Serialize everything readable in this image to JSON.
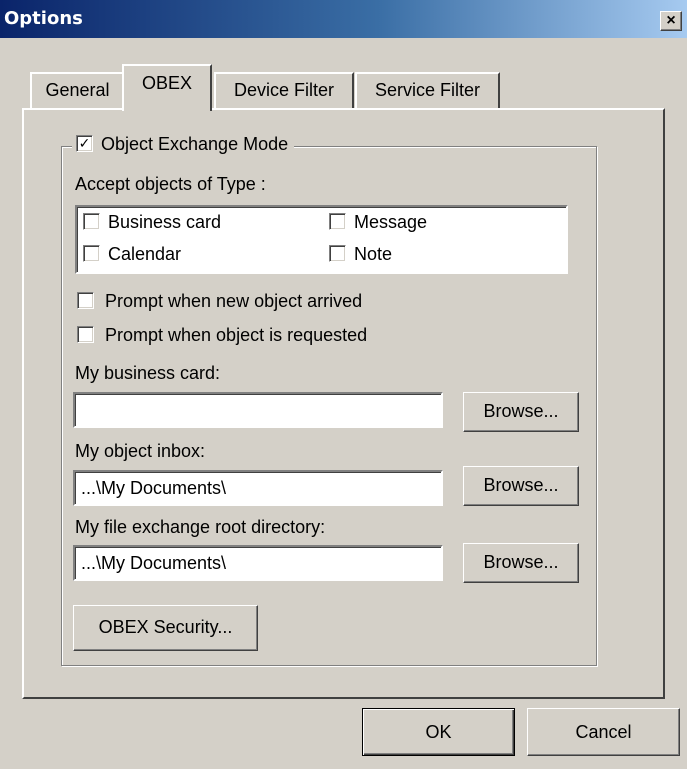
{
  "window": {
    "title": "Options",
    "close_glyph": "×"
  },
  "tabs": [
    {
      "label": "General",
      "selected": false
    },
    {
      "label": "OBEX",
      "selected": true
    },
    {
      "label": "Device Filter",
      "selected": false
    },
    {
      "label": "Service Filter",
      "selected": false
    }
  ],
  "obex": {
    "mode_label": "Object Exchange Mode",
    "mode_checked": true,
    "accept_label": "Accept objects of Type :",
    "types": [
      {
        "label": "Business card",
        "checked": false
      },
      {
        "label": "Message",
        "checked": false
      },
      {
        "label": "Calendar",
        "checked": false
      },
      {
        "label": "Note",
        "checked": false
      }
    ],
    "prompt_arrived": {
      "label": "Prompt when new object arrived",
      "checked": false
    },
    "prompt_requested": {
      "label": "Prompt when object is requested",
      "checked": false
    },
    "business_card": {
      "label": "My business card:",
      "value": "",
      "browse": "Browse..."
    },
    "inbox": {
      "label": "My object inbox:",
      "value": "...\\My Documents\\",
      "browse": "Browse..."
    },
    "root_dir": {
      "label": "My file exchange root directory:",
      "value": "...\\My Documents\\",
      "browse": "Browse..."
    },
    "security_button": "OBEX Security..."
  },
  "footer": {
    "ok": "OK",
    "cancel": "Cancel"
  },
  "colors": {
    "titlebar_start": "#0a246a",
    "titlebar_end": "#a6caf0",
    "face": "#d4d0c8"
  },
  "check_glyph": "✓"
}
